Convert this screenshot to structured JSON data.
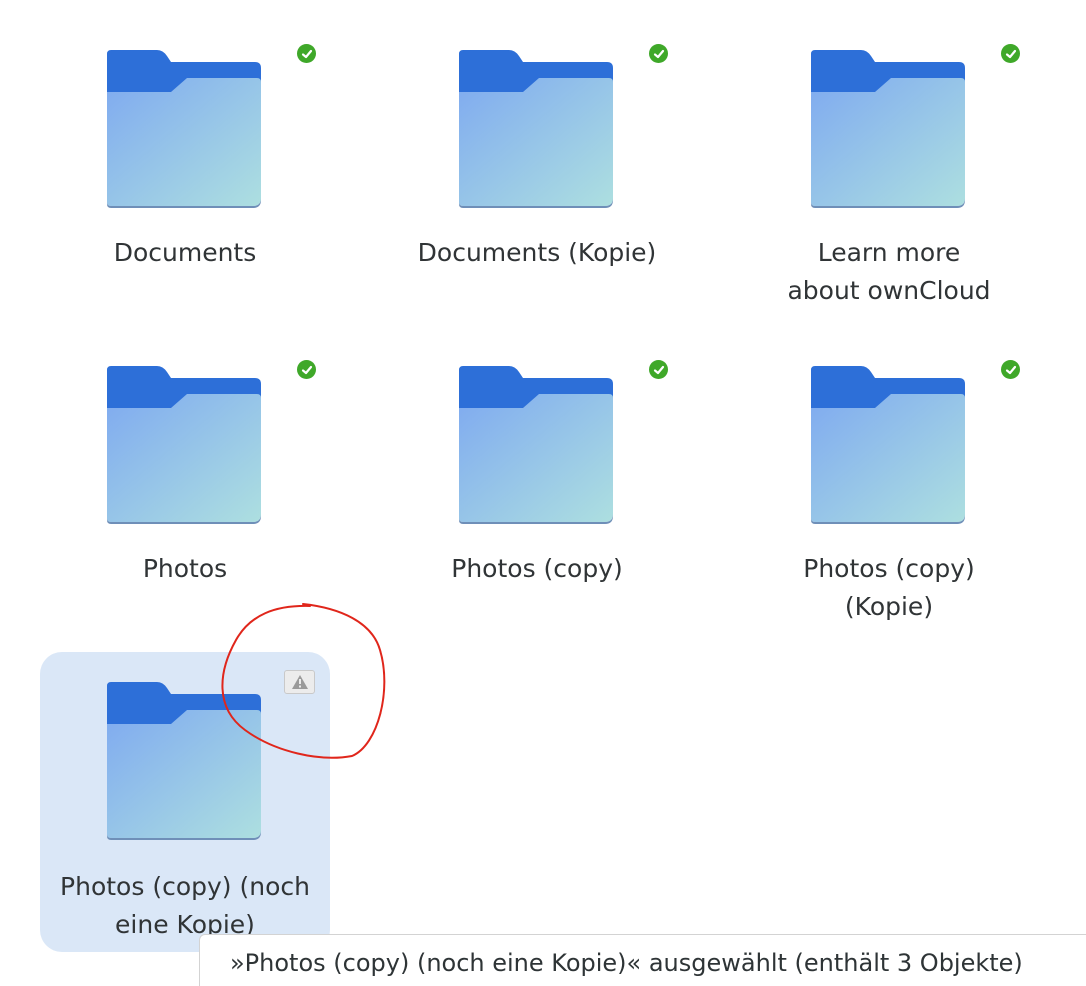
{
  "files": {
    "items": [
      {
        "name": "Documents",
        "status": "synced"
      },
      {
        "name": "Documents (Kopie)",
        "status": "synced"
      },
      {
        "name": "Learn more about ownCloud",
        "status": "synced"
      },
      {
        "name": "Photos",
        "status": "synced"
      },
      {
        "name": "Photos (copy)",
        "status": "synced"
      },
      {
        "name": "Photos (copy) (Kopie)",
        "status": "synced"
      },
      {
        "name": "Photos (copy) (noch eine Kopie)",
        "status": "warning",
        "selected": true
      }
    ]
  },
  "status_bar": {
    "text": "»Photos (copy) (noch eine Kopie)« ausgewählt  (enthält 3 Objekte)"
  },
  "colors": {
    "folder_back": "#2d6fd8",
    "folder_front_top": "#86aef0",
    "folder_front_bottom": "#a9dbe0",
    "sync_ok": "#3fa829",
    "selection": "#dae7f7",
    "annotation": "#e0261b"
  },
  "icons": {
    "folder": "folder-icon",
    "synced": "checkmark-badge-icon",
    "warning": "warning-badge-icon"
  }
}
